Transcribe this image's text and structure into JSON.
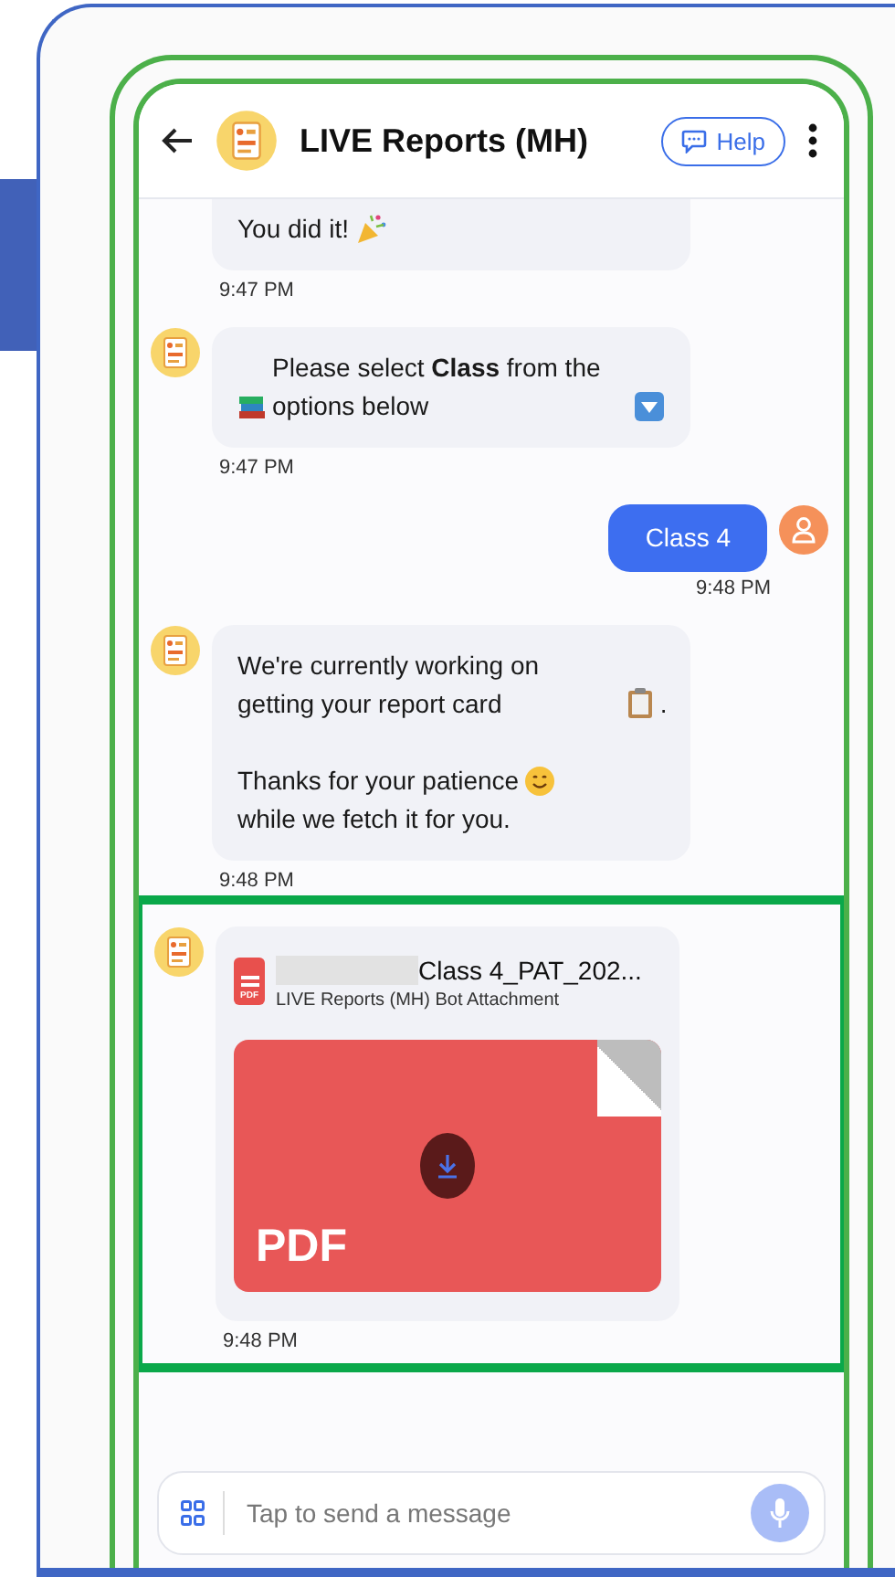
{
  "header": {
    "title": "LIVE Reports (MH)",
    "help_label": "Help"
  },
  "messages": [
    {
      "kind": "bot",
      "avatar": false,
      "highlighted": false,
      "paragraphs": [
        [
          "You did it!"
        ]
      ],
      "time": "9:47 PM"
    },
    {
      "kind": "bot",
      "avatar": true,
      "highlighted": false,
      "paragraphs": [
        [
          "Please select **Class** from the options below"
        ]
      ],
      "time": "9:47 PM"
    },
    {
      "kind": "user",
      "avatar": true,
      "highlighted": false,
      "paragraphs": [
        [
          "Class 4"
        ]
      ],
      "time": "9:48 PM"
    },
    {
      "kind": "bot",
      "avatar": true,
      "highlighted": false,
      "paragraphs": [
        [
          "We're currently working on getting your report card",
          "."
        ],
        [
          "Thanks for your patience",
          "while we fetch it for you."
        ]
      ],
      "time": "9:48 PM"
    },
    {
      "kind": "attachment",
      "avatar": true,
      "highlighted": true,
      "file_name": "Class 4_PAT_202...",
      "file_icon_label": "PDF",
      "subtitle": "LIVE Reports (MH) Bot Attachment",
      "preview_label": "PDF",
      "time": "9:48 PM"
    }
  ],
  "composer": {
    "placeholder": "Tap to send a message"
  }
}
